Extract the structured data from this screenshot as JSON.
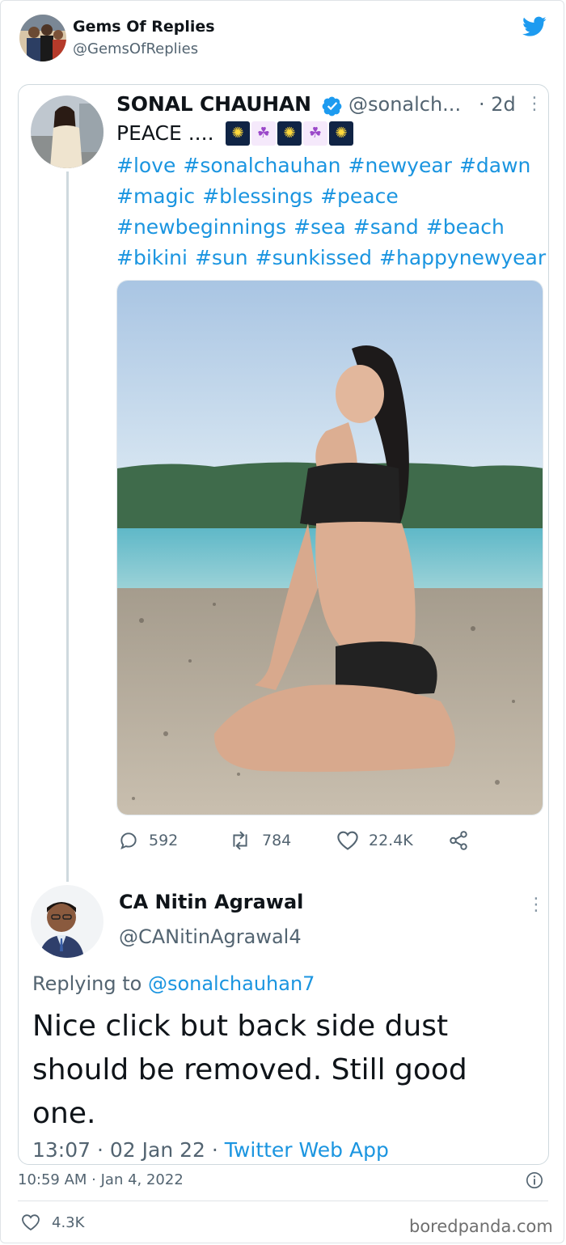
{
  "outer": {
    "name": "Gems Of Replies",
    "handle": "@GemsOfReplies",
    "timestamp": "10:59 AM · Jan 4, 2022",
    "likes": "4.3K"
  },
  "quoted": {
    "name": "SONAL CHAUHAN",
    "handle": "@sonalch...",
    "time": "· 2d",
    "text": "PEACE ....",
    "emojis": [
      "fireworks",
      "mermaid",
      "fireworks",
      "mermaid",
      "fireworks"
    ],
    "hashtags": [
      "#love",
      "#sonalchauhan",
      "#newyear",
      "#dawn",
      "#magic",
      "#blessings",
      "#peace",
      "#newbeginnings",
      "#sea",
      "#sand",
      "#beach",
      "#bikini",
      "#sun",
      "#sunkissed",
      "#happynewyear"
    ],
    "stats": {
      "replies": "592",
      "retweets": "784",
      "likes": "22.4K"
    }
  },
  "reply": {
    "name": "CA Nitin Agrawal",
    "handle": "@CANitinAgrawal4",
    "replying_prefix": "Replying to",
    "replying_to": "@sonalchauhan7",
    "text": "Nice click but back side dust should be removed. Still good one.",
    "time": "13:07 · 02 Jan 22 ·",
    "app": "Twitter Web App"
  },
  "watermark": "boredpanda.com",
  "colors": {
    "link": "#1b95e0",
    "muted": "#536471",
    "twitter_blue": "#1d9bf0"
  }
}
